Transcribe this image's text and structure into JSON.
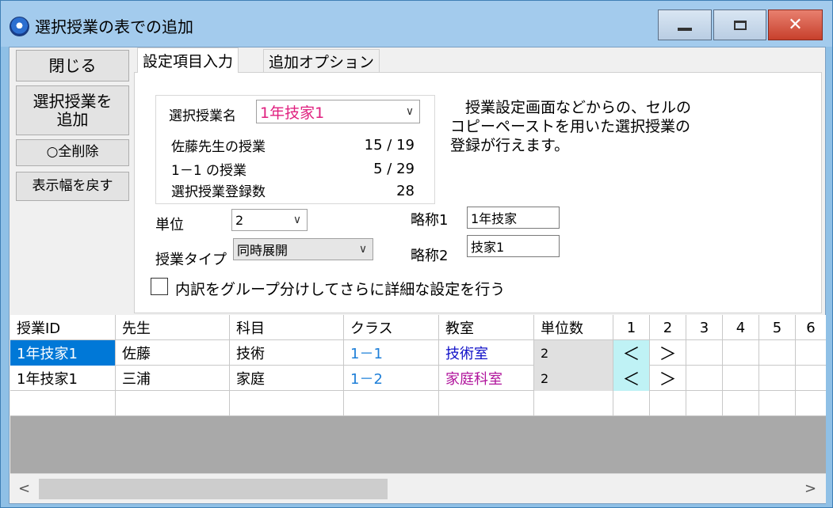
{
  "window": {
    "title": "選択授業の表での追加"
  },
  "sidebar": {
    "close_label": "閉じる",
    "add_label_line1": "選択授業を",
    "add_label_line2": "追加",
    "delete_all_label": "○全削除",
    "reset_width_label": "表示幅を戻す"
  },
  "tabs": {
    "active_label": "設定項目入力",
    "inactive_label": "追加オプション"
  },
  "form": {
    "elective_name_label": "選択授業名",
    "elective_name_value": "1年技家1",
    "teacher_lessons_label": "佐藤先生の授業",
    "teacher_lessons_value": "15 / 19",
    "class_lessons_label": "1－1 の授業",
    "class_lessons_value": "5 / 29",
    "registered_count_label": "選択授業登録数",
    "registered_count_value": "28",
    "unit_label": "単位",
    "unit_value": "2",
    "lesson_type_label": "授業タイプ",
    "lesson_type_value": "同時展開",
    "abbrev1_label": "略称1",
    "abbrev1_value": "1年技家",
    "abbrev2_label": "略称2",
    "abbrev2_value": "技家1",
    "description_line1": "　授業設定画面などからの、セルの",
    "description_line2": "コピーペーストを用いた選択授業の",
    "description_line3": "登録が行えます。",
    "checkbox_label": "内訳をグループ分けしてさらに詳細な設定を行う"
  },
  "table": {
    "headers": [
      "授業ID",
      "先生",
      "科目",
      "クラス",
      "教室",
      "単位数",
      "1",
      "2",
      "3",
      "4",
      "5",
      "6"
    ],
    "rows": [
      [
        "1年技家1",
        "佐藤",
        "技術",
        "1－1",
        "技術室",
        "2",
        "＜",
        "＞",
        "",
        "",
        "",
        ""
      ],
      [
        "1年技家1",
        "三浦",
        "家庭",
        "1－2",
        "家庭科室",
        "2",
        "＜",
        "＞",
        "",
        "",
        "",
        ""
      ]
    ]
  },
  "scrollbar": {
    "left_arrow": "<",
    "right_arrow": ">"
  },
  "colors": {
    "name_value": "#e0207f",
    "class_text": "#1e7fd8",
    "room1_text": "#1010c8",
    "room2_text": "#b0149c",
    "selected_cell_bg": "#0078d7",
    "highlight_cyan": "#bff2f5",
    "unit_cell_bg": "#e0e0e0"
  }
}
